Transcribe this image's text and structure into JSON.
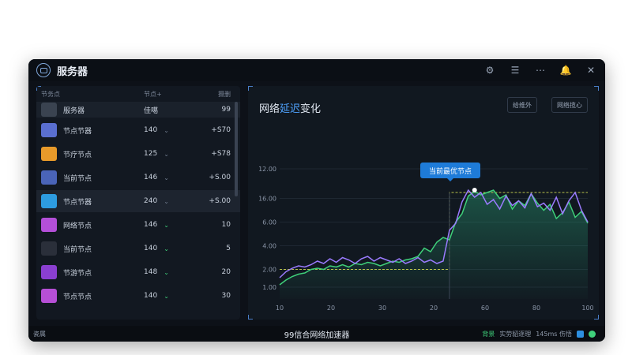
{
  "app": {
    "title": "服务器"
  },
  "left": {
    "headers": {
      "name": "节务点",
      "node": "节点+",
      "delay": "摄删"
    },
    "rows": [
      {
        "name": "服务器",
        "node": "佳噶",
        "delay": "99",
        "icon": "folder-icon",
        "color": "#3a4350"
      },
      {
        "name": "节点节器",
        "node": "140",
        "delay": "+S70",
        "icon": "server-icon",
        "color": "#5a6fd0"
      },
      {
        "name": "节疗节点",
        "node": "125",
        "delay": "+S78",
        "icon": "coin-icon",
        "color": "#e89a2a"
      },
      {
        "name": "当前节点",
        "node": "146",
        "delay": "+S.00",
        "icon": "bed-icon",
        "color": "#4a64b8"
      },
      {
        "name": "节点节器",
        "node": "240",
        "delay": "+S.00",
        "icon": "monitor-icon",
        "color": "#2d9ce0"
      },
      {
        "name": "网络节点",
        "node": "146",
        "delay": "10",
        "icon": "bag-icon",
        "color": "#b34fd8"
      },
      {
        "name": "当前节点",
        "node": "140",
        "delay": "5",
        "icon": "colorful-icon",
        "color": "#2a2f3a"
      },
      {
        "name": "节游节点",
        "node": "148",
        "delay": "20",
        "icon": "swirl-icon",
        "color": "#8a3fd0"
      },
      {
        "name": "节点节点",
        "node": "140",
        "delay": "30",
        "icon": "pen-icon",
        "color": "#b64fd6"
      }
    ]
  },
  "panel": {
    "title_a": "网络",
    "title_b": "延迟",
    "title_c": "变化",
    "btn1": "给维外",
    "btn2": "网络揽心",
    "tooltip": "当前最优节点"
  },
  "statusbar": {
    "left": "瓷属",
    "center": "99信合网络加速器",
    "s1": "背景",
    "s2": "实劳貂逐理",
    "s3": "145ms 伤悟"
  },
  "colors": {
    "accent": "#4fa3ff",
    "green": "#3fd07a",
    "purple": "#9b7bff",
    "dash": "#b9c24a"
  },
  "chart_data": {
    "type": "line",
    "ylim": [
      0,
      14
    ],
    "yticks": [
      "1.00",
      "2.00",
      "4.00",
      "6.00",
      "16.00",
      "12.00"
    ],
    "xticks": [
      "10",
      "20",
      "30",
      "20",
      "60",
      "80",
      "100"
    ],
    "series": [
      {
        "color": "#3fd07a",
        "values": [
          1.2,
          1.6,
          1.9,
          2.1,
          2.2,
          2.5,
          2.6,
          2.5,
          2.8,
          2.7,
          2.9,
          2.7,
          3.0,
          2.9,
          3.1,
          3.0,
          2.8,
          3.0,
          3.2,
          3.1,
          3.3,
          3.4,
          3.6,
          4.3,
          4.0,
          4.8,
          5.2,
          5.0,
          6.5,
          7.2,
          8.7,
          9.1,
          8.8,
          9.0,
          9.2,
          8.5,
          8.8,
          7.6,
          8.3,
          7.9,
          8.9,
          8.1,
          7.5,
          8.0,
          6.8,
          7.3,
          8.2,
          6.9,
          7.4,
          6.4
        ]
      },
      {
        "color": "#9b7bff",
        "values": [
          1.8,
          2.3,
          2.6,
          2.8,
          2.7,
          2.9,
          3.2,
          3.0,
          3.4,
          3.1,
          3.5,
          3.3,
          3.0,
          3.4,
          3.6,
          3.2,
          3.5,
          3.3,
          3.1,
          3.4,
          3.0,
          3.2,
          3.5,
          3.1,
          3.3,
          3.0,
          3.2,
          5.8,
          6.4,
          8.2,
          9.2,
          8.6,
          9.0,
          8.0,
          8.4,
          7.6,
          8.7,
          7.9,
          8.3,
          7.7,
          8.9,
          7.8,
          8.1,
          7.5,
          8.6,
          7.2,
          8.3,
          9.0,
          7.5,
          6.5
        ]
      }
    ],
    "baseline_dashed": [
      2.5,
      9.0
    ],
    "highlight_point": {
      "x": 33,
      "y": 9.2
    }
  }
}
